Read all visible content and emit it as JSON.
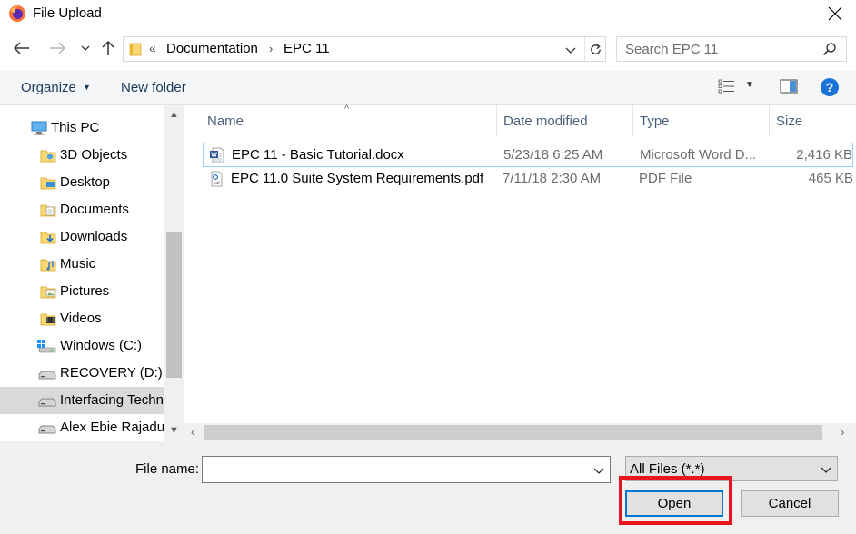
{
  "window": {
    "title": "File Upload",
    "app_icon": "firefox-icon"
  },
  "address_bar": {
    "overflow_glyph": "«",
    "breadcrumbs": [
      "Documentation",
      "EPC 11"
    ]
  },
  "search": {
    "placeholder": "Search EPC 11"
  },
  "toolbar": {
    "organize_label": "Organize",
    "new_folder_label": "New folder"
  },
  "nav_pane": {
    "items": [
      {
        "label": "This PC",
        "icon": "this-pc-icon"
      },
      {
        "label": "3D Objects",
        "icon": "3d-objects-icon"
      },
      {
        "label": "Desktop",
        "icon": "desktop-folder-icon"
      },
      {
        "label": "Documents",
        "icon": "documents-folder-icon"
      },
      {
        "label": "Downloads",
        "icon": "downloads-folder-icon"
      },
      {
        "label": "Music",
        "icon": "music-folder-icon"
      },
      {
        "label": "Pictures",
        "icon": "pictures-folder-icon"
      },
      {
        "label": "Videos",
        "icon": "videos-folder-icon"
      },
      {
        "label": "Windows (C:)",
        "icon": "windows-drive-icon"
      },
      {
        "label": "RECOVERY (D:)",
        "icon": "drive-icon"
      },
      {
        "label": "Interfacing Technolog",
        "icon": "drive-icon"
      },
      {
        "label": "Alex Ebie Rajadurai",
        "icon": "drive-icon"
      }
    ],
    "selected_index": 10
  },
  "file_list": {
    "columns": [
      "Name",
      "Date modified",
      "Type",
      "Size"
    ],
    "files": [
      {
        "name": "EPC 11 - Basic Tutorial.docx",
        "date": "5/23/18 6:25 AM",
        "type": "Microsoft Word D...",
        "size": "2,416 KB",
        "icon": "word-document-icon"
      },
      {
        "name": "EPC 11.0 Suite System Requirements.pdf",
        "date": "7/11/18 2:30 AM",
        "type": "PDF File",
        "size": "465 KB",
        "icon": "pdf-file-icon"
      }
    ]
  },
  "bottom": {
    "file_name_label": "File name:",
    "file_name_value": "",
    "file_type_filter": "All Files (*.*)",
    "open_label": "Open",
    "cancel_label": "Cancel"
  },
  "colors": {
    "highlight_box": "#e8141e",
    "accent": "#0078d7",
    "help_icon": "#1a73d8"
  }
}
